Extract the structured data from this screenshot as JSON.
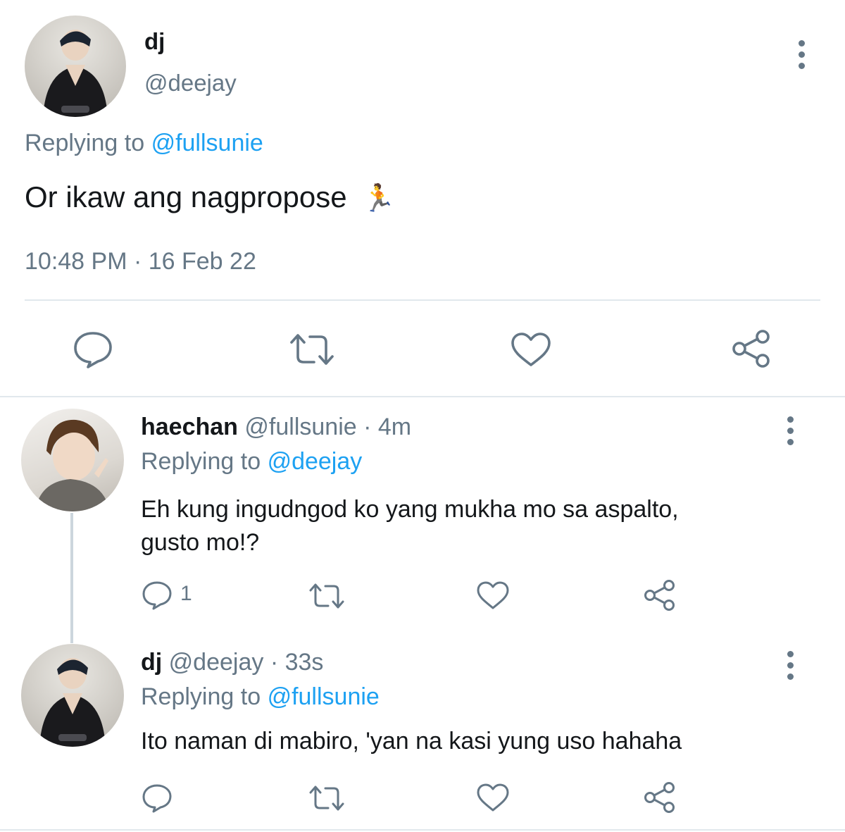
{
  "main_tweet": {
    "display_name": "dj",
    "handle": "@deejay",
    "replying_prefix": "Replying to",
    "replying_handle": "@fullsunie",
    "text": "Or ikaw ang nagpropose",
    "emoji": "🏃",
    "timestamp": "10:48 PM · 16 Feb 22",
    "actions": [
      "reply-icon",
      "retweet-icon",
      "like-icon",
      "share-icon"
    ]
  },
  "replies": [
    {
      "display_name": "haechan",
      "handle": "@fullsunie",
      "time": "· 4m",
      "replying_prefix": "Replying to",
      "replying_handle": "@deejay",
      "text_line1": "Eh kung ingudngod ko yang mukha mo sa aspalto,",
      "text_line2": "gusto mo!?",
      "reply_count": "1"
    },
    {
      "display_name": "dj",
      "handle": "@deejay",
      "time": "· 33s",
      "replying_prefix": "Replying to",
      "replying_handle": "@fullsunie",
      "text_line1": "Ito naman di mabiro, 'yan na kasi yung uso hahaha",
      "reply_count": ""
    }
  ],
  "colors": {
    "text": "#14171a",
    "secondary": "#657786",
    "link": "#1da1f2",
    "divider": "#e1e8ed"
  }
}
